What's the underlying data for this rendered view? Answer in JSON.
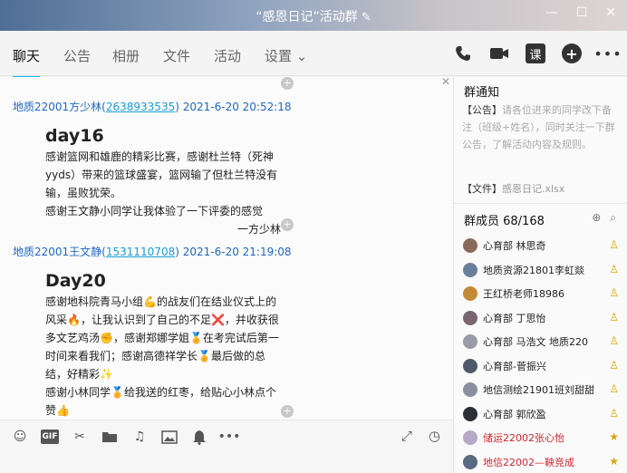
{
  "window": {
    "title": "“感恩日记”活动群",
    "controls": [
      "—",
      "☐",
      "✕"
    ]
  },
  "tabs": [
    "聊天",
    "公告",
    "相册",
    "文件",
    "活动",
    "设置 ⌄"
  ],
  "toolbar": {
    "class_label": "课"
  },
  "messages": [
    {
      "sender": "地质22001方少林(",
      "qq": "2638933535",
      "close_paren": ")",
      "time": "2021-6-20 20:52:18",
      "heading": "day16",
      "lines": [
        "感谢篮网和雄鹿的精彩比赛，感谢杜兰特（死神yyds）带来的篮球盛宴，篮网输了但杜兰特没有输，虽败犹荣。",
        "感谢王文静小同学让我体验了一下评委的感觉"
      ],
      "signature": "一方少林"
    },
    {
      "sender": "地质22001王文静(",
      "qq": "1531110708",
      "close_paren": ")",
      "time": "2021-6-20 21:19:08",
      "heading": "Day20",
      "lines": [
        "感谢地科院青马小组💪的战友们在结业仪式上的风采🔥，让我认识到了自己的不足❌，并收获很多文艺鸡汤✊，感谢郑娜学姐🏅在考完试后第一时间来看我们；感谢高德祥学长🏅最后做的总结，好精彩✨",
        "感谢小林同学🏅给我送的红枣，给贴心小林点个赞👍"
      ]
    }
  ],
  "notice": {
    "title": "群通知",
    "tag": "【公告】",
    "text": "请各位进来的同学改下备注（班级+姓名），同时关注一下群公告，了解活动内容及规则。",
    "file_tag": "【文件】",
    "file_name": "感恩日记.xlsx"
  },
  "members": {
    "title": "群成员 68/168",
    "list": [
      {
        "name": "心育部  林思奇",
        "avatar_color": "#8a6a5a",
        "red": false
      },
      {
        "name": "地质资源21801李虹燚",
        "avatar_color": "#6a7f9a",
        "red": false
      },
      {
        "name": "王红桥老师18986",
        "avatar_color": "#c48a3a",
        "red": false
      },
      {
        "name": "心育部  丁思怡",
        "avatar_color": "#7a6670",
        "red": false
      },
      {
        "name": "心育部 马浩文 地质220",
        "avatar_color": "#9a9aa8",
        "red": false
      },
      {
        "name": "心育部-菅振兴",
        "avatar_color": "#4e5a6a",
        "red": false
      },
      {
        "name": "地信测绘21901班刘甜甜",
        "avatar_color": "#8a8fa0",
        "red": false
      },
      {
        "name": "心育部 郭欣盈",
        "avatar_color": "#2e2e36",
        "red": false
      },
      {
        "name": "储运22002张心怡",
        "avatar_color": "#b8a8c8",
        "red": true
      },
      {
        "name": "地信22002—鞅竞成",
        "avatar_color": "#5a6a80",
        "red": true
      }
    ]
  }
}
